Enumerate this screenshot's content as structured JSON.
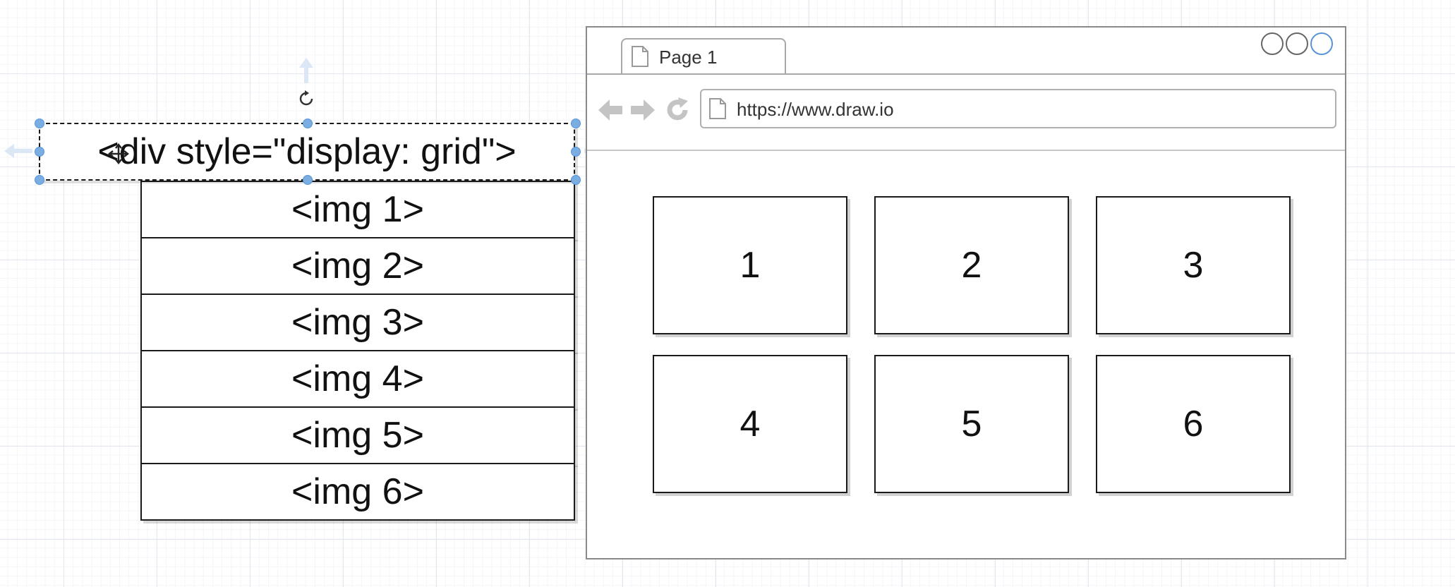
{
  "diagram": {
    "grid_container_label": "<div style=\"display: grid\">",
    "img_items": [
      "<img 1>",
      "<img 2>",
      "<img 3>",
      "<img 4>",
      "<img 5>",
      "<img 6>"
    ]
  },
  "browser": {
    "tab_label": "Page 1",
    "url": "https://www.draw.io",
    "grid_cells": [
      "1",
      "2",
      "3",
      "4",
      "5",
      "6"
    ]
  },
  "icons": {
    "back": "arrow-left-icon",
    "forward": "arrow-right-icon",
    "reload": "reload-icon",
    "page": "document-icon",
    "rotate": "rotate-icon"
  },
  "colors": {
    "selection": "#7aaee3",
    "nav_icons": "#c4c4c4",
    "stroke": "#1a1a1a"
  }
}
